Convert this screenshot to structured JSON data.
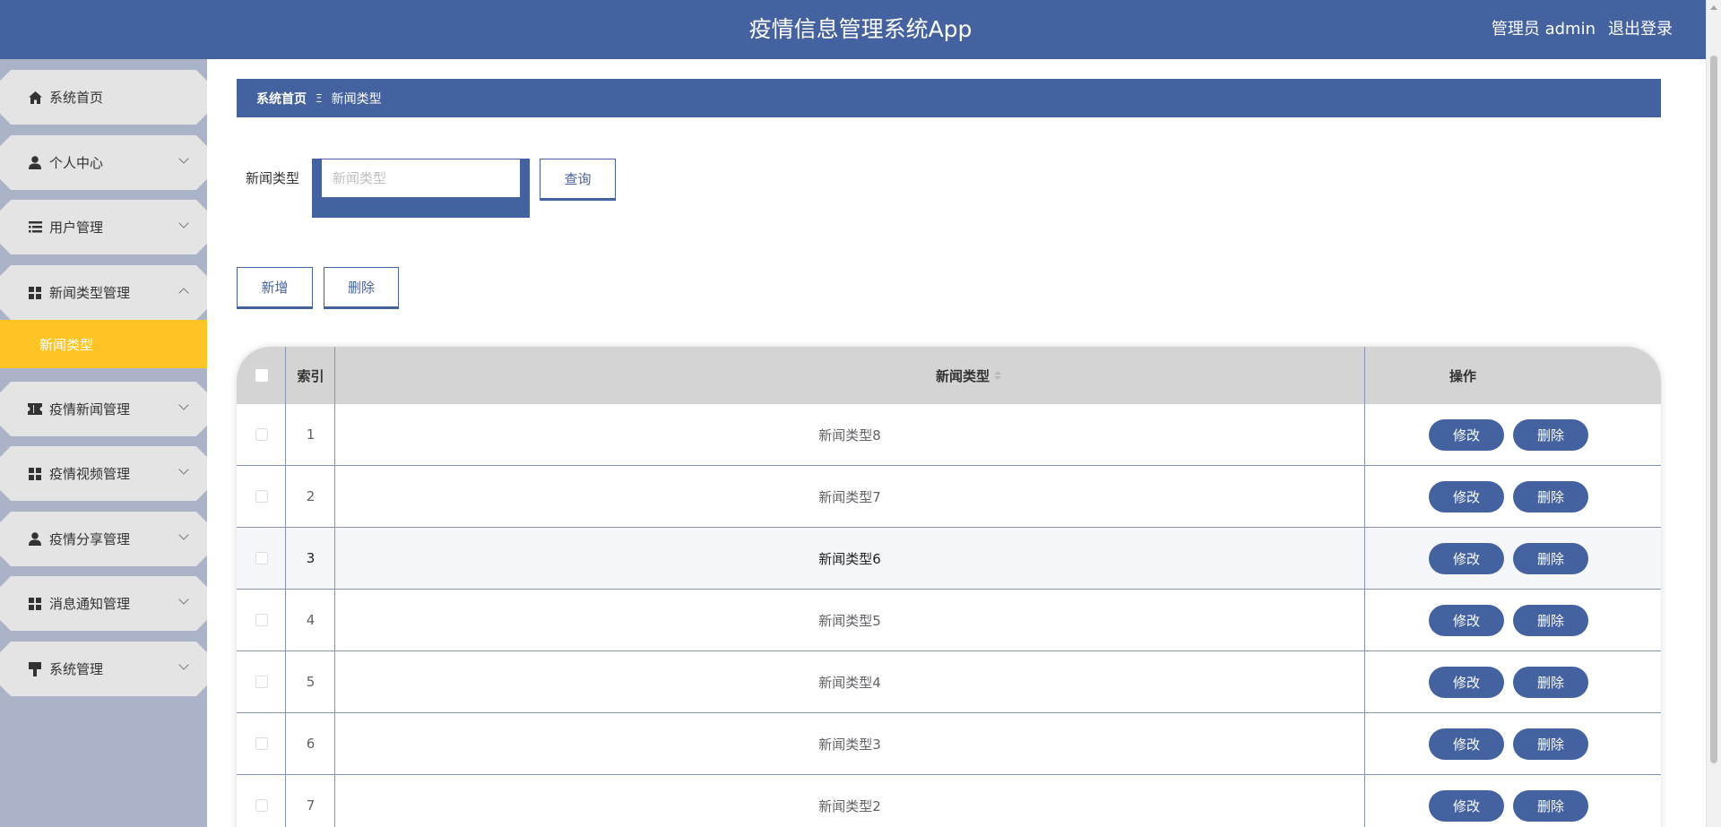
{
  "header": {
    "title": "疫情信息管理系统App",
    "user_role": "管理员 admin",
    "logout": "退出登录"
  },
  "sidebar": {
    "items": [
      {
        "label": "系统首页",
        "icon": "home-icon",
        "has_arrow": false
      },
      {
        "label": "个人中心",
        "icon": "user-icon",
        "has_arrow": true
      },
      {
        "label": "用户管理",
        "icon": "list-icon",
        "has_arrow": true
      },
      {
        "label": "新闻类型管理",
        "icon": "grid-icon",
        "has_arrow": true,
        "expanded": true
      },
      {
        "label": "疫情新闻管理",
        "icon": "ticket-icon",
        "has_arrow": true
      },
      {
        "label": "疫情视频管理",
        "icon": "grid-icon",
        "has_arrow": true
      },
      {
        "label": "疫情分享管理",
        "icon": "user-icon",
        "has_arrow": true
      },
      {
        "label": "消息通知管理",
        "icon": "grid-icon",
        "has_arrow": true
      },
      {
        "label": "系统管理",
        "icon": "brush-icon",
        "has_arrow": true
      }
    ],
    "active_submenu": "新闻类型"
  },
  "breadcrumb": {
    "home": "系统首页",
    "separator": "Ξ",
    "current": "新闻类型"
  },
  "search": {
    "label": "新闻类型",
    "placeholder": "新闻类型",
    "value": "",
    "query_button": "查询"
  },
  "actions": {
    "add": "新增",
    "delete": "删除"
  },
  "table": {
    "headers": {
      "index": "索引",
      "type": "新闻类型",
      "ops": "操作"
    },
    "edit_label": "修改",
    "delete_label": "删除",
    "rows": [
      {
        "index": "1",
        "type": "新闻类型8"
      },
      {
        "index": "2",
        "type": "新闻类型7"
      },
      {
        "index": "3",
        "type": "新闻类型6"
      },
      {
        "index": "4",
        "type": "新闻类型5"
      },
      {
        "index": "5",
        "type": "新闻类型4"
      },
      {
        "index": "6",
        "type": "新闻类型3"
      },
      {
        "index": "7",
        "type": "新闻类型2"
      }
    ]
  },
  "colors": {
    "primary": "#4562a0",
    "active_menu": "#ffc524",
    "sidebar_bg": "#aab3c8",
    "menu_item_bg": "#e4e4e4"
  }
}
